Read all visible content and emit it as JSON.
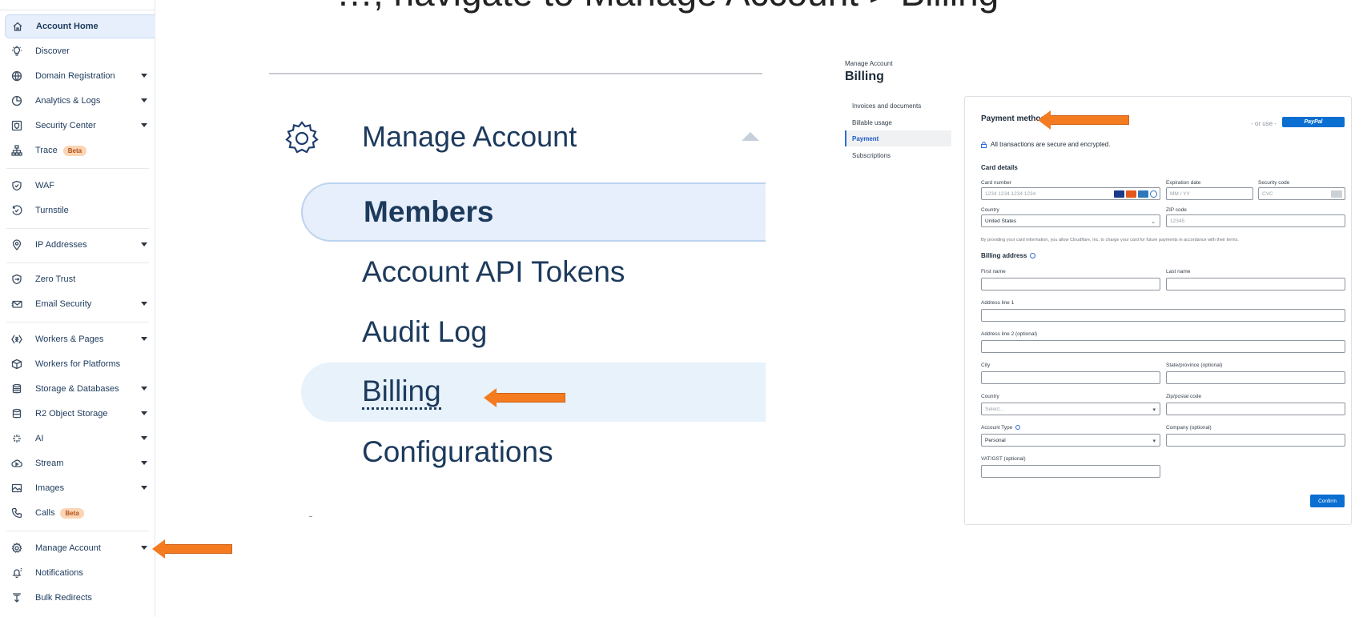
{
  "headline_partial": "…, navigate to Manage Account > Billing",
  "sidebar": {
    "items": [
      {
        "label": "Account Home",
        "icon": "home-icon",
        "caret": false,
        "active": true
      },
      {
        "label": "Discover",
        "icon": "lightbulb-icon",
        "caret": false
      },
      {
        "label": "Domain Registration",
        "icon": "globe-icon",
        "caret": true
      },
      {
        "label": "Analytics & Logs",
        "icon": "pie-chart-icon",
        "caret": true
      },
      {
        "label": "Security Center",
        "icon": "shield-square-icon",
        "caret": true
      },
      {
        "label": "Trace",
        "icon": "network-icon",
        "caret": false,
        "badge": "Beta"
      },
      {
        "label": "WAF",
        "icon": "waf-icon",
        "caret": false
      },
      {
        "label": "Turnstile",
        "icon": "turnstile-icon",
        "caret": false
      },
      {
        "label": "IP Addresses",
        "icon": "location-pin-icon",
        "caret": true
      },
      {
        "label": "Zero Trust",
        "icon": "zero-trust-icon",
        "caret": false
      },
      {
        "label": "Email Security",
        "icon": "email-icon",
        "caret": true
      },
      {
        "label": "Workers & Pages",
        "icon": "workers-icon",
        "caret": true
      },
      {
        "label": "Workers for Platforms",
        "icon": "box-icon",
        "caret": false
      },
      {
        "label": "Storage & Databases",
        "icon": "database-icon",
        "caret": true
      },
      {
        "label": "R2 Object Storage",
        "icon": "storage-icon",
        "caret": true
      },
      {
        "label": "AI",
        "icon": "sparkle-icon",
        "caret": true
      },
      {
        "label": "Stream",
        "icon": "cloud-play-icon",
        "caret": true
      },
      {
        "label": "Images",
        "icon": "image-icon",
        "caret": true
      },
      {
        "label": "Calls",
        "icon": "phone-icon",
        "caret": false,
        "badge": "Beta"
      },
      {
        "label": "Manage Account",
        "icon": "gear-icon",
        "caret": true
      },
      {
        "label": "Notifications",
        "icon": "bell-icon",
        "caret": false
      },
      {
        "label": "Bulk Redirects",
        "icon": "redirect-icon",
        "caret": false
      }
    ]
  },
  "zoom": {
    "title": "Manage Account",
    "items": [
      "Members",
      "Account API Tokens",
      "Audit Log",
      "Billing",
      "Configurations"
    ]
  },
  "billing": {
    "breadcrumb": "Manage Account",
    "title": "Billing",
    "nav": [
      "Invoices and documents",
      "Billable usage",
      "Payment",
      "Subscriptions"
    ],
    "payment_method_title": "Payment method",
    "or_use": "- or use -",
    "paypal_label": "PayPal",
    "secure_text": "All transactions are secure and encrypted.",
    "card_details_title": "Card details",
    "card_number_label": "Card number",
    "card_number_placeholder": "1234 1234 1234 1234",
    "expiration_label": "Expiration date",
    "expiration_placeholder": "MM / YY",
    "security_label": "Security code",
    "security_placeholder": "CVC",
    "country_label": "Country",
    "country_value": "United States",
    "zip_label": "ZIP code",
    "zip_placeholder": "12345",
    "consent_text": "By providing your card information, you allow Cloudflare, Inc. to charge your card for future payments in accordance with their terms.",
    "billing_address_title": "Billing address",
    "first_name_label": "First name",
    "last_name_label": "Last name",
    "address1_label": "Address line 1",
    "address2_label": "Address line 2 (optional)",
    "city_label": "City",
    "state_label": "State/province (optional)",
    "country2_label": "Country",
    "country2_placeholder": "Select...",
    "postal_label": "Zip/postal code",
    "account_type_label": "Account Type",
    "account_type_value": "Personal",
    "company_label": "Company (optional)",
    "vat_label": "VAT/GST (optional)",
    "confirm_label": "Confirm"
  },
  "colors": {
    "arrow": "#f47b20",
    "accent": "#0a6fd1",
    "active_bg": "#e6effb"
  }
}
